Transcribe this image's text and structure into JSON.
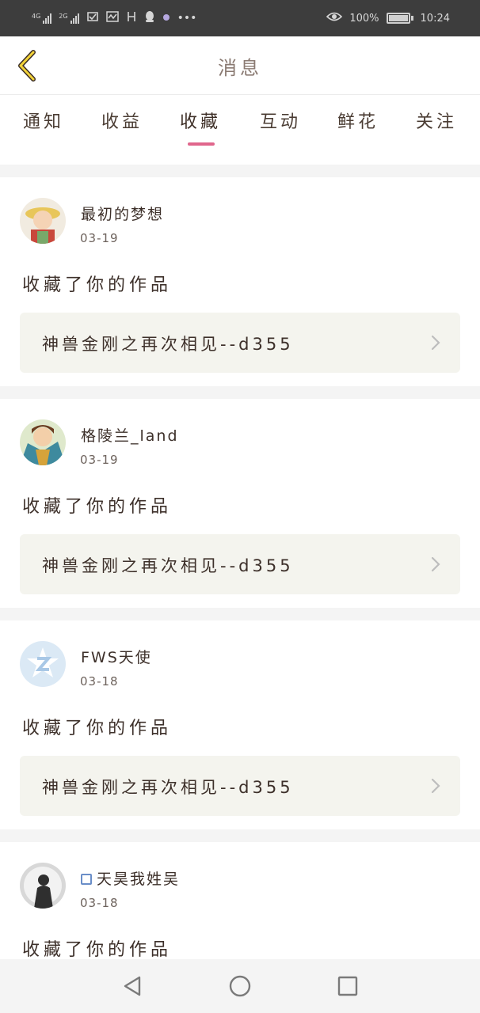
{
  "status_bar": {
    "signal1_label": "4G",
    "signal2_label": "2G",
    "battery_text": "100%",
    "time": "10:24"
  },
  "header": {
    "title": "消息"
  },
  "tabs": [
    {
      "label": "通知",
      "active": false
    },
    {
      "label": "收益",
      "active": false
    },
    {
      "label": "收藏",
      "active": true
    },
    {
      "label": "互动",
      "active": false
    },
    {
      "label": "鲜花",
      "active": false
    },
    {
      "label": "关注",
      "active": false
    }
  ],
  "accent_color": "#e0668c",
  "items": [
    {
      "username": "最初的梦想",
      "date": "03-19",
      "action": "收藏了你的作品",
      "work_title": "神兽金刚之再次相见--d355",
      "avatar": "anime-avatar"
    },
    {
      "username": "格陵兰_land",
      "date": "03-19",
      "action": "收藏了你的作品",
      "work_title": "神兽金刚之再次相见--d355",
      "avatar": "anime-avatar"
    },
    {
      "username": "FWS天使",
      "date": "03-18",
      "action": "收藏了你的作品",
      "work_title": "神兽金刚之再次相见--d355",
      "avatar": "qq-default-avatar"
    },
    {
      "username": "天昊我姓吴",
      "date": "03-18",
      "action": "收藏了你的作品",
      "work_title": "",
      "avatar": "photo-avatar"
    }
  ]
}
